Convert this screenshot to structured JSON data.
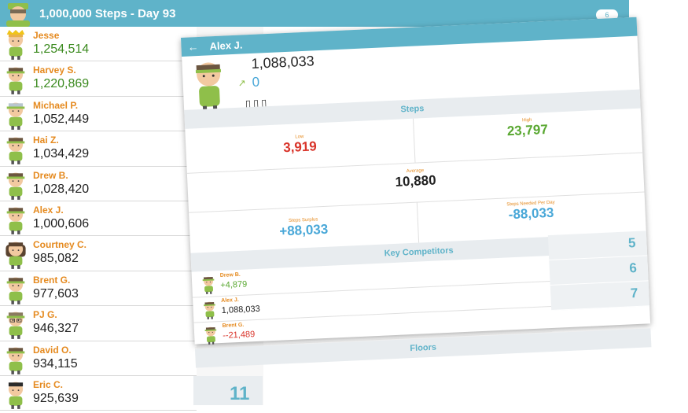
{
  "app": {
    "title": "1,000,000 Steps - Day 93",
    "count": "6"
  },
  "leaderboard": [
    {
      "name": "Jesse",
      "steps": "1,254,514",
      "green": true,
      "look": "king"
    },
    {
      "name": "Harvey S.",
      "steps": "1,220,869",
      "green": true,
      "look": "band"
    },
    {
      "name": "Michael P.",
      "steps": "1,052,449",
      "green": false,
      "look": "gray"
    },
    {
      "name": "Hai Z.",
      "steps": "1,034,429",
      "green": false,
      "look": "band"
    },
    {
      "name": "Drew B.",
      "steps": "1,028,420",
      "green": false,
      "look": "band"
    },
    {
      "name": "Alex J.",
      "steps": "1,000,606",
      "green": false,
      "look": "band"
    },
    {
      "name": "Courtney C.",
      "steps": "985,082",
      "green": false,
      "look": "longhair"
    },
    {
      "name": "Brent G.",
      "steps": "977,603",
      "green": false,
      "look": "band"
    },
    {
      "name": "PJ G.",
      "steps": "946,327",
      "green": false,
      "look": "glasses"
    },
    {
      "name": "David O.",
      "steps": "934,115",
      "green": false,
      "look": "band"
    },
    {
      "name": "Eric C.",
      "steps": "925,639",
      "green": false,
      "look": "dark"
    }
  ],
  "side_rank": "11",
  "panel": {
    "title": "Alex J.",
    "total_steps": "1,088,033",
    "floors": "0",
    "steps_section": "Steps",
    "low_label": "Low",
    "low_value": "3,919",
    "high_label": "High",
    "high_value": "23,797",
    "avg_label": "Average",
    "avg_value": "10,880",
    "surplus_label": "Steps Surplus",
    "surplus_value": "+88,033",
    "needed_label": "Steps Needed Per Day",
    "needed_value": "-88,033",
    "competitors_section": "Key Competitors",
    "competitors": [
      {
        "name": "Drew B.",
        "value": "+4,879",
        "color": "#5aa832"
      },
      {
        "name": "Alex J.",
        "value": "1,088,033",
        "color": "#222222"
      },
      {
        "name": "Brent G.",
        "value": "--21,489",
        "color": "#d9352b"
      }
    ],
    "ranks": [
      "5",
      "6",
      "7"
    ],
    "floors_section": "Floors"
  },
  "colors": {
    "accent": "#5fb3c9",
    "name_orange": "#e58a1f",
    "low_red": "#d9352b",
    "high_green": "#5aa832"
  }
}
